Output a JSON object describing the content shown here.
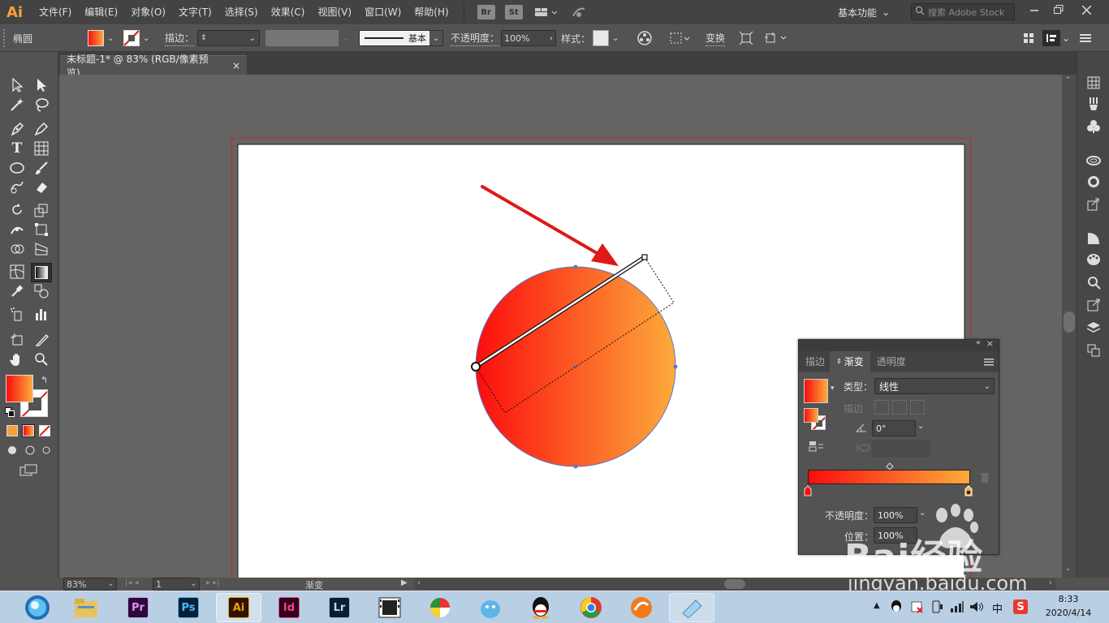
{
  "app": {
    "logo": "Ai"
  },
  "menu": [
    "文件(F)",
    "编辑(E)",
    "对象(O)",
    "文字(T)",
    "选择(S)",
    "效果(C)",
    "视图(V)",
    "窗口(W)",
    "帮助(H)"
  ],
  "menu_icons": {
    "bridge": "Br",
    "stock": "St"
  },
  "workspace": "基本功能",
  "search_placeholder": "搜索 Adobe Stock",
  "control": {
    "object_type": "椭圆",
    "stroke_label": "描边：",
    "stroke_style": "基本",
    "opacity_label": "不透明度：",
    "opacity_value": "100%",
    "style_label": "样式：",
    "transform_label": "变换"
  },
  "document": {
    "tab_title": "未标题-1* @ 83% (RGB/像素预览)",
    "close": "×"
  },
  "status": {
    "zoom": "83%",
    "artboard": "1",
    "tool_name": "渐变"
  },
  "gradient_panel": {
    "tabs": [
      "描边",
      "渐变",
      "透明度"
    ],
    "type_label": "类型：",
    "type_value": "线性",
    "stroke_label": "描边",
    "angle_value": "0°",
    "opacity_label": "不透明度：",
    "opacity_value": "100%",
    "position_label": "位置：",
    "position_value": "100%"
  },
  "gradient": {
    "start_color": "#fb0d0d",
    "end_color": "#fdab3b"
  },
  "colors": {
    "accent_red": "#e01818",
    "ui_bg": "#535353",
    "artboard_border": "#c8262a"
  },
  "taskbar": {
    "apps": [
      "Pr",
      "Ps",
      "Ai",
      "Id",
      "Lr"
    ],
    "time": "8:33",
    "date": "2020/4/14",
    "ime": "中"
  },
  "watermark": {
    "brand": "Bai经验",
    "url": "jingyan.baidu.com"
  }
}
